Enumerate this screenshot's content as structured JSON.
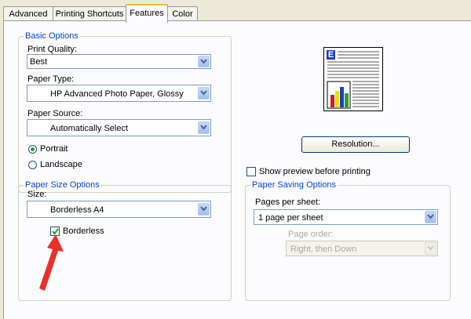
{
  "tabs": [
    {
      "label": "Advanced"
    },
    {
      "label": "Printing Shortcuts"
    },
    {
      "label": "Features"
    },
    {
      "label": "Color"
    }
  ],
  "basic_options": {
    "title": "Basic Options",
    "print_quality_label": "Print Quality:",
    "print_quality_value": "Best",
    "paper_type_label": "Paper Type:",
    "paper_type_value": "HP Advanced Photo Paper, Glossy",
    "paper_source_label": "Paper Source:",
    "paper_source_value": "Automatically Select",
    "portrait_label": "Portrait",
    "landscape_label": "Landscape",
    "orientation_selected": "Portrait"
  },
  "preview": {
    "logo_letter": "E",
    "resolution_button": "Resolution...",
    "show_preview_label": "Show preview before printing",
    "show_preview_checked": false
  },
  "paper_size_options": {
    "title": "Paper Size Options",
    "size_label": "Size:",
    "size_value": "Borderless  A4",
    "borderless_label": "Borderless",
    "borderless_checked": true
  },
  "paper_saving_options": {
    "title": "Paper Saving Options",
    "pages_per_sheet_label": "Pages per sheet:",
    "pages_per_sheet_value": "1 page per sheet",
    "page_order_label": "Page order:",
    "page_order_value": "Right, then Down"
  },
  "colors": {
    "accent": "#0046d5",
    "annotation_arrow": "#e8312b"
  }
}
